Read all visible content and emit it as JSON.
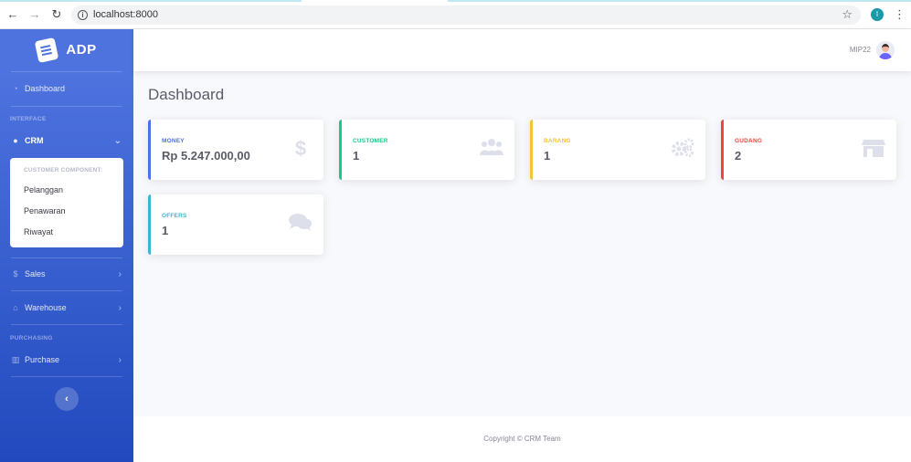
{
  "browser": {
    "url": "localhost:8000",
    "profile_initial": "I"
  },
  "brand": {
    "name": "ADP"
  },
  "sidebar": {
    "dashboard_label": "Dashboard",
    "heading_interface": "INTERFACE",
    "crm_label": "CRM",
    "submenu": {
      "header": "CUSTOMER COMPONENT:",
      "items": [
        "Pelanggan",
        "Penawaran",
        "Riwayat"
      ]
    },
    "sales_label": "Sales",
    "warehouse_label": "Warehouse",
    "heading_purchasing": "PURCHASING",
    "purchase_label": "Purchase"
  },
  "topbar": {
    "user_name": "MIP22"
  },
  "page": {
    "title": "Dashboard"
  },
  "cards": [
    {
      "label": "MONEY",
      "value": "Rp 5.247.000,00",
      "color": "#4e73df",
      "icon": "dollar-icon"
    },
    {
      "label": "CUSTOMER",
      "value": "1",
      "color": "#1cc88a",
      "icon": "users-icon"
    },
    {
      "label": "BARANG",
      "value": "1",
      "color": "#f6c23e",
      "icon": "cogs-icon"
    },
    {
      "label": "GUDANG",
      "value": "2",
      "color": "#e74a3b",
      "icon": "store-icon"
    },
    {
      "label": "OFFERS",
      "value": "1",
      "color": "#36b9cc",
      "icon": "comments-icon"
    }
  ],
  "footer": {
    "copyright": "Copyright © CRM Team"
  }
}
